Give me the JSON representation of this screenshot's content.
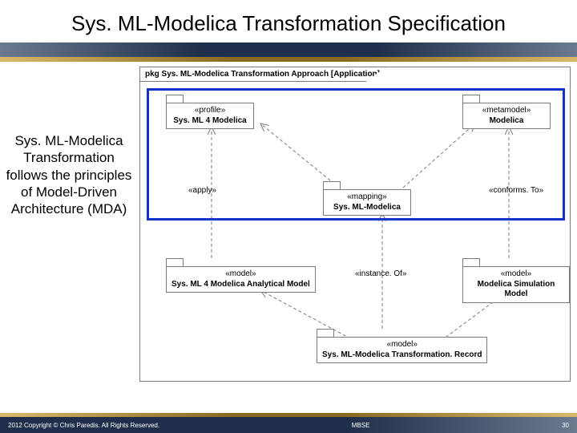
{
  "title": "Sys. ML-Modelica Transformation Specification",
  "sidetext": "Sys. ML-Modelica Transformation follows the principles of Model-Driven Architecture (MDA)",
  "frame_label": "pkg Sys. ML-Modelica Transformation Approach [Application]",
  "nodes": {
    "profile": {
      "stereotype": "«profile»",
      "name": "Sys. ML 4 Modelica"
    },
    "metamodel": {
      "stereotype": "«metamodel»",
      "name": "Modelica"
    },
    "mapping": {
      "stereotype": "«mapping»",
      "name": "Sys. ML-Modelica"
    },
    "amodel": {
      "stereotype": "«model»",
      "name": "Sys. ML 4 Modelica Analytical Model"
    },
    "smodel": {
      "stereotype": "«model»",
      "name": "Modelica Simulation Model"
    },
    "record": {
      "stereotype": "«model»",
      "name": "Sys. ML-Modelica Transformation. Record"
    }
  },
  "edges": {
    "apply": "«apply»",
    "conforms": "«conforms. To»",
    "instanceof": "«instance. Of»"
  },
  "footer": {
    "copyright": "2012 Copyright © Chris Paredis. All Rights Reserved.",
    "center": "MBSE",
    "page": "30"
  }
}
